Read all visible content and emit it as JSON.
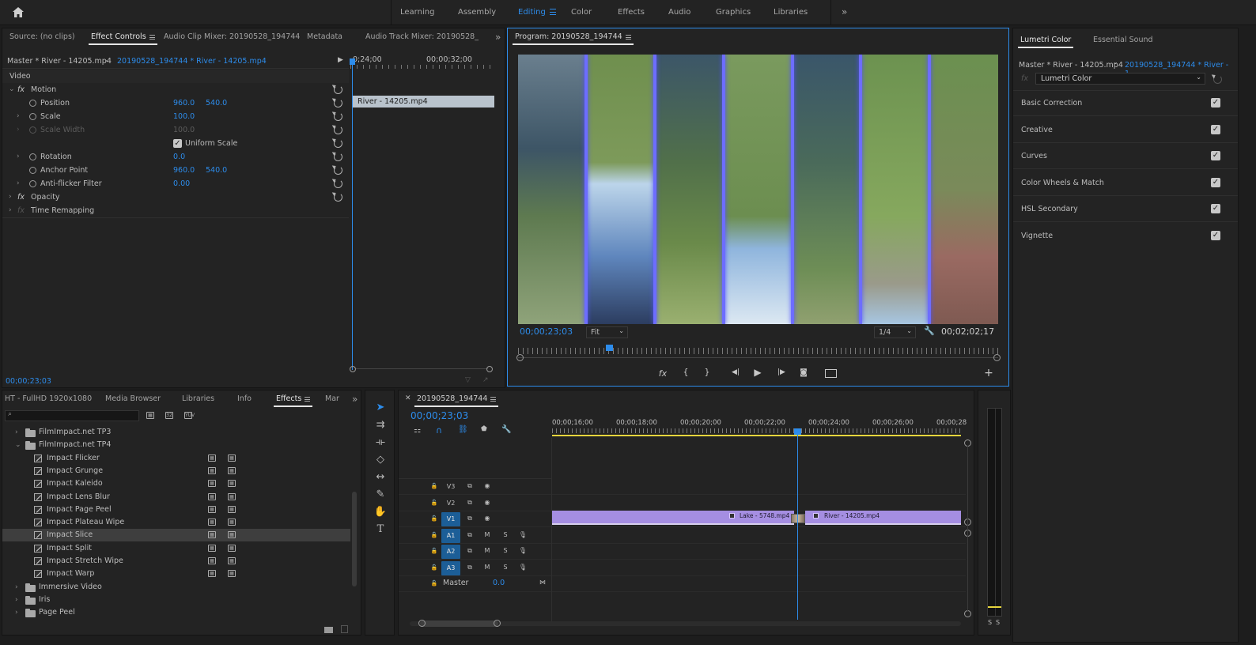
{
  "topbar": {
    "workspaces": [
      "Learning",
      "Assembly",
      "Editing",
      "Color",
      "Effects",
      "Audio",
      "Graphics",
      "Libraries"
    ],
    "active": "Editing",
    "overflow": "»"
  },
  "source_panel": {
    "tabs": [
      "Source: (no clips)",
      "Effect Controls",
      "Audio Clip Mixer: 20190528_194744",
      "Metadata",
      "Audio Track Mixer: 20190528_19474"
    ],
    "overflow": "»",
    "master_clip": "Master * River - 14205.mp4",
    "sequence_clip": "20190528_194744 * River - 14205.mp4",
    "ruler": [
      "0;24;00",
      "00;00;32;00"
    ],
    "clip_bar": "River - 14205.mp4",
    "section": "Video",
    "params": {
      "motion": "Motion",
      "position_label": "Position",
      "position_x": "960.0",
      "position_y": "540.0",
      "scale_label": "Scale",
      "scale_value": "100.0",
      "scale_width_label": "Scale Width",
      "scale_width_value": "100.0",
      "uniform_scale": "Uniform Scale",
      "rotation_label": "Rotation",
      "rotation_value": "0.0",
      "anchor_label": "Anchor Point",
      "anchor_x": "960.0",
      "anchor_y": "540.0",
      "antiflicker_label": "Anti-flicker Filter",
      "antiflicker_value": "0.00",
      "opacity": "Opacity",
      "time_remap": "Time Remapping",
      "fx": "fx"
    },
    "timecode": "00;00;23;03"
  },
  "program_monitor": {
    "title": "Program: 20190528_194744",
    "timecode": "00;00;23;03",
    "fit": "Fit",
    "resolution": "1/4",
    "duration": "00;02;02;17",
    "playhead_fraction": 0.19
  },
  "lumetri": {
    "tabs": [
      "Lumetri Color",
      "Essential Sound"
    ],
    "master": "Master * River - 14205.mp4",
    "sequence": "20190528_194744 * River - 1...",
    "effect": "Lumetri Color",
    "sections": [
      "Basic Correction",
      "Creative",
      "Curves",
      "Color Wheels & Match",
      "HSL Secondary",
      "Vignette"
    ]
  },
  "project_panel": {
    "tabs": [
      "HT - FullHD 1920x1080",
      "Media Browser",
      "Libraries",
      "Info",
      "Effects",
      "Mar"
    ],
    "overflow": "»",
    "tree": [
      {
        "label": "FilmImpact.net TP3",
        "type": "folder",
        "open": false
      },
      {
        "label": "FilmImpact.net TP4",
        "type": "folder",
        "open": true
      },
      {
        "label": "Impact Flicker",
        "type": "effect"
      },
      {
        "label": "Impact Grunge",
        "type": "effect"
      },
      {
        "label": "Impact Kaleido",
        "type": "effect"
      },
      {
        "label": "Impact Lens Blur",
        "type": "effect"
      },
      {
        "label": "Impact Page Peel",
        "type": "effect"
      },
      {
        "label": "Impact Plateau Wipe",
        "type": "effect"
      },
      {
        "label": "Impact Slice",
        "type": "effect",
        "selected": true
      },
      {
        "label": "Impact Split",
        "type": "effect"
      },
      {
        "label": "Impact Stretch Wipe",
        "type": "effect"
      },
      {
        "label": "Impact Warp",
        "type": "effect"
      },
      {
        "label": "Immersive Video",
        "type": "folder",
        "open": false
      },
      {
        "label": "Iris",
        "type": "folder",
        "open": false
      },
      {
        "label": "Page Peel",
        "type": "folder",
        "open": false
      }
    ]
  },
  "timeline": {
    "title": "20190528_194744",
    "timecode": "00;00;23;03",
    "ruler": [
      "00;00;16;00",
      "00;00;18;00",
      "00;00;20;00",
      "00;00;22;00",
      "00;00;24;00",
      "00;00;26;00",
      "00;00;28"
    ],
    "video_tracks": [
      "V3",
      "V2",
      "V1"
    ],
    "audio_tracks": [
      "A1",
      "A2",
      "A3"
    ],
    "track_buttons": {
      "mute": "M",
      "solo": "S"
    },
    "master_label": "Master",
    "master_value": "0.0",
    "clips": [
      "Lake - 5748.mp4",
      "River - 14205.mp4"
    ]
  },
  "audio_meter": {
    "labels": [
      "S",
      "S"
    ]
  },
  "colors": {
    "accent": "#2d8ceb",
    "clip": "#a58ee2",
    "track_on": "#1c5e97",
    "playhead": "#2d8ceb",
    "work_area": "#e6d53c"
  }
}
